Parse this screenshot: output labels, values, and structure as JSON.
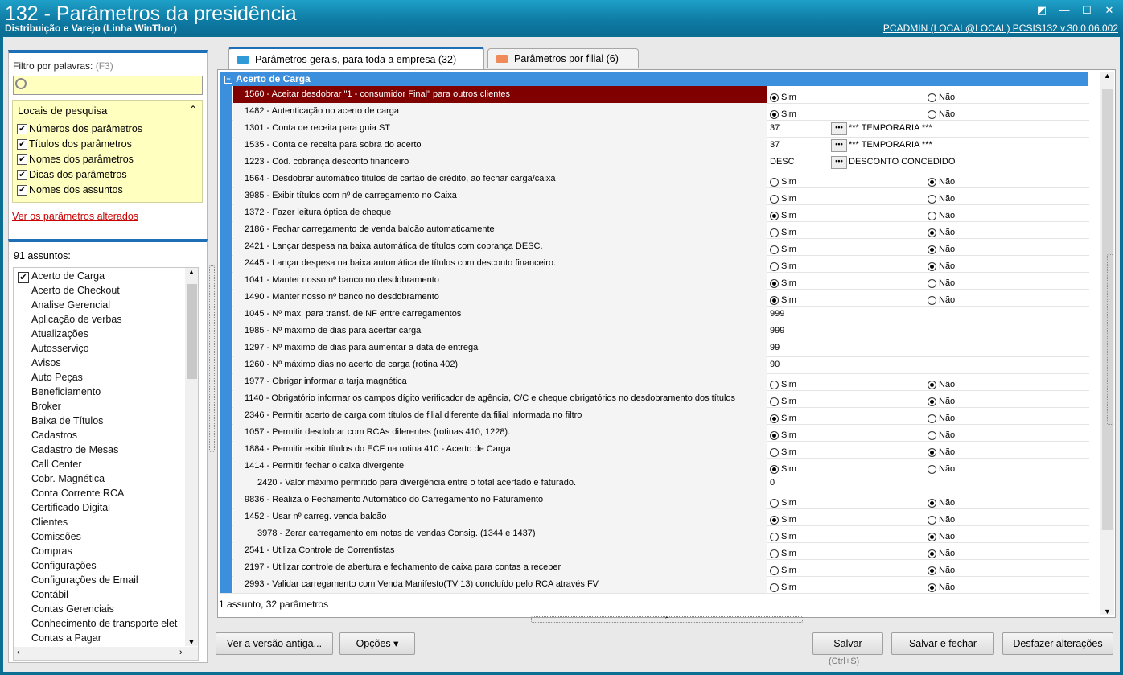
{
  "window": {
    "title": "132 - Parâmetros da presidência",
    "subtitle": "Distribuição e Varejo (Linha WinThor)",
    "userinfo": "PCADMIN (LOCAL@LOCAL)  PCSIS132  v.30.0.06.002"
  },
  "filter": {
    "label": "Filtro por palavras:",
    "hotkey": "(F3)",
    "value": ""
  },
  "locais": {
    "header": "Locais de pesquisa",
    "options": [
      "Números dos parâmetros",
      "Títulos dos parâmetros",
      "Nomes dos parâmetros",
      "Dicas dos parâmetros",
      "Nomes dos assuntos"
    ]
  },
  "altered_link": "Ver os parâmetros alterados",
  "assuntos": {
    "count_label": "91 assuntos:",
    "items": [
      "Acerto de Carga",
      "Acerto de Checkout",
      "Analise Gerencial",
      "Aplicação de verbas",
      "Atualizações",
      "Autosserviço",
      "Avisos",
      "Auto Peças",
      "Beneficiamento",
      "Broker",
      "Baixa de Títulos",
      "Cadastros",
      "Cadastro de Mesas",
      "Call Center",
      "Cobr. Magnética",
      "Conta Corrente RCA",
      "Certificado Digital",
      "Clientes",
      "Comissões",
      "Compras",
      "Configurações",
      "Configurações de Email",
      "Contábil",
      "Contas Gerenciais",
      "Conhecimento de transporte elet",
      "Contas a Pagar"
    ]
  },
  "tabs": [
    {
      "label": "Parâmetros gerais, para toda a empresa  (32)",
      "color": "#2f9ad6"
    },
    {
      "label": "Parâmetros por filial  (6)",
      "color": "#f08a5a"
    }
  ],
  "group": "Acerto de Carga",
  "yes": "Sim",
  "no": "Não",
  "rows": [
    {
      "name": "1560 - Aceitar desdobrar \"1 - consumidor Final\" para outros clientes",
      "type": "radio",
      "value": "sim",
      "sel": true
    },
    {
      "name": "1482 - Autenticação no acerto de carga",
      "type": "radio",
      "value": "sim"
    },
    {
      "name": "1301 - Conta de receita para guia ST",
      "type": "lookup",
      "value": "37",
      "desc": "*** TEMPORARIA ***"
    },
    {
      "name": "1535 - Conta de receita para sobra do acerto",
      "type": "lookup",
      "value": "37",
      "desc": "*** TEMPORARIA ***"
    },
    {
      "name": "1223 - Cód. cobrança desconto financeiro",
      "type": "lookup",
      "value": "DESC",
      "desc": "DESCONTO CONCEDIDO"
    },
    {
      "name": "1564 - Desdobrar automático títulos de cartão de crédito, ao fechar carga/caixa",
      "type": "radio",
      "value": "nao"
    },
    {
      "name": "3985 - Exibir títulos com nº de carregamento no Caixa",
      "type": "radio",
      "value": ""
    },
    {
      "name": "1372 - Fazer leitura óptica de cheque",
      "type": "radio",
      "value": "sim"
    },
    {
      "name": "2186 - Fechar carregamento de venda balcão automaticamente",
      "type": "radio",
      "value": "nao"
    },
    {
      "name": "2421 - Lançar despesa na baixa automática de títulos com cobrança DESC.",
      "type": "radio",
      "value": "nao"
    },
    {
      "name": "2445 - Lançar despesa na baixa automática de títulos com desconto financeiro.",
      "type": "radio",
      "value": "nao"
    },
    {
      "name": "1041 - Manter nosso nº banco no desdobramento",
      "type": "radio",
      "value": "sim"
    },
    {
      "name": "1490 - Manter nosso nº banco no desdobramento",
      "type": "radio",
      "value": "sim"
    },
    {
      "name": "1045 - Nº max. para transf. de NF entre carregamentos",
      "type": "text",
      "value": "999"
    },
    {
      "name": "1985 - Nº máximo de dias para acertar carga",
      "type": "text",
      "value": "999"
    },
    {
      "name": "1297 - Nº máximo de dias para aumentar a data de entrega",
      "type": "text",
      "value": "99"
    },
    {
      "name": "1260 - Nº máximo dias no acerto de carga (rotina 402)",
      "type": "text",
      "value": "90"
    },
    {
      "name": "1977 - Obrigar informar a tarja magnética",
      "type": "radio",
      "value": "nao"
    },
    {
      "name": "1140 - Obrigatório informar os campos dígito verificador de agência, C/C e cheque obrigatórios no desdobramento dos títulos",
      "type": "radio",
      "value": "nao"
    },
    {
      "name": "2346 - Permitir acerto de carga com títulos de filial diferente da filial informada no filtro",
      "type": "radio",
      "value": "sim"
    },
    {
      "name": "1057 - Permitir desdobrar com RCAs diferentes (rotinas 410, 1228).",
      "type": "radio",
      "value": "sim"
    },
    {
      "name": "1884 - Permitir exibir títulos do ECF na rotina 410 - Acerto de Carga",
      "type": "radio",
      "value": "nao"
    },
    {
      "name": "1414 - Permitir fechar o caixa divergente",
      "type": "radio",
      "value": "sim"
    },
    {
      "name": "2420 - Valor máximo permitido para divergência entre o total acertado e faturado.",
      "type": "text",
      "value": "0",
      "indent": true
    },
    {
      "name": "9836 - Realiza o Fechamento Automático do Carregamento no Faturamento",
      "type": "radio",
      "value": "nao"
    },
    {
      "name": "1452 - Usar nº carreg. venda balcão",
      "type": "radio",
      "value": "sim"
    },
    {
      "name": "3978 - Zerar carregamento em notas de vendas Consig. (1344 e 1437)",
      "type": "radio",
      "value": "nao",
      "indent": true
    },
    {
      "name": "2541 - Utiliza Controle de Correntistas",
      "type": "radio",
      "value": "nao"
    },
    {
      "name": "2197 - Utilizar controle de abertura e fechamento de caixa para contas a receber",
      "type": "radio",
      "value": "nao"
    },
    {
      "name": "2993 - Validar carregamento com Venda Manifesto(TV 13) concluído pelo RCA através FV",
      "type": "radio",
      "value": "nao"
    }
  ],
  "status": "1 assunto, 32 parâmetros",
  "buttons": {
    "old_version": "Ver a versão antiga...",
    "options": "Opções ▾",
    "save": "Salvar",
    "save_hint": "(Ctrl+S)",
    "save_close": "Salvar e fechar",
    "undo": "Desfazer alterações"
  }
}
